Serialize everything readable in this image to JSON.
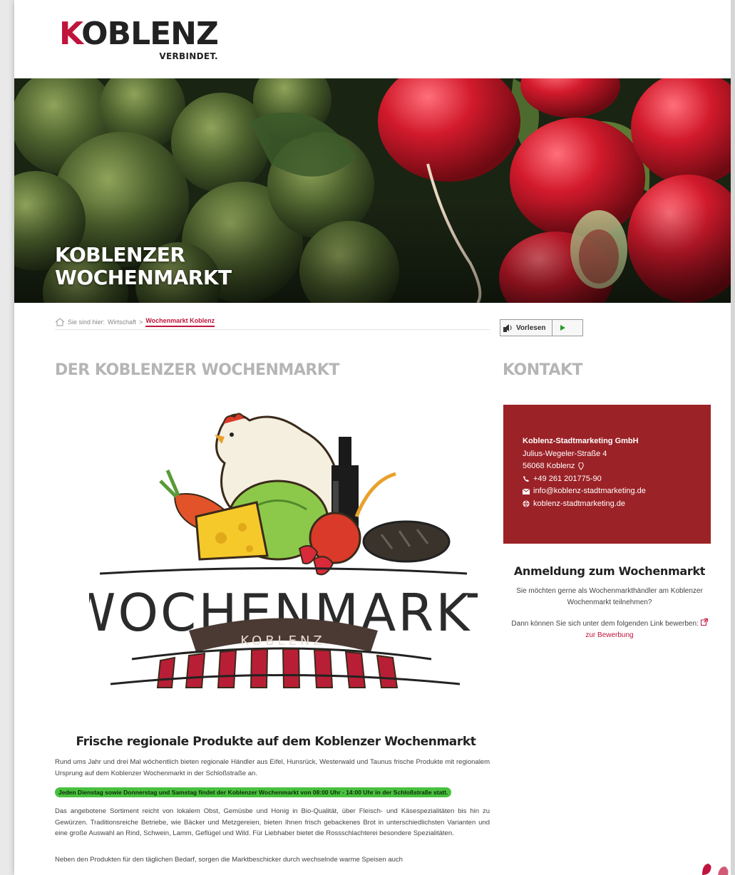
{
  "header": {
    "logo_word": "KOBLENZ",
    "logo_k": "K",
    "logo_rest": "OBLENZ",
    "logo_tagline": "VERBINDET."
  },
  "hero": {
    "title_line1": "KOBLENZER",
    "title_line2": "WOCHENMARKT"
  },
  "breadcrumb": {
    "prefix": "Sie sind hier:",
    "parent": "Wirtschaft",
    "separator": ">",
    "current": "Wochenmarkt Koblenz"
  },
  "reader": {
    "label": "Vorlesen"
  },
  "main": {
    "heading": "DER KOBLENZER WOCHENMARKT",
    "logo": {
      "word": "WOCHENMARKT",
      "sub": "KOBLENZ"
    },
    "subheading": "Frische regionale Produkte auf dem Koblenzer Wochenmarkt",
    "paragraph1": "Rund ums Jahr und drei Mal wöchentlich bieten regionale Händler aus Eifel, Hunsrück, Westerwald und Taunus frische Produkte mit regionalem Ursprung auf dem Koblenzer Wochenmarkt in der Schloßstraße an.",
    "highlight": "Jeden Dienstag sowie Donnerstag und Samstag findet der Koblenzer Wochenmarkt von 08:00 Uhr - 14:00 Uhr in der Schloßstraße statt.",
    "paragraph2": "Das angebotene Sortiment reicht von lokalem Obst, Gemüsbe und Honig in Bio-Qualität, über Fleisch- und Käsespezialitäten bis hin zu Gewürzen. Traditionsreiche Betriebe, wie Bäcker und Metzgereien, bieten Ihnen frisch gebackenes Brot in unterschiedlichsten Varianten und eine große Auswahl an Rind, Schwein, Lamm, Geflügel und Wild. Für Liebhaber bietet die Rossschlachterei besondere Spezialitäten.",
    "paragraph3": "Neben den Produkten für den täglichen Bedarf, sorgen die Marktbeschicker durch wechselnde warme Speisen auch"
  },
  "sidebar": {
    "heading": "KONTAKT",
    "contact": {
      "company": "Koblenz-Stadtmarketing GmbH",
      "street": "Julius-Wegeler-Straße 4",
      "city": "56068 Koblenz",
      "phone": "+49 261 201775-90",
      "email": "info@koblenz-stadtmarketing.de",
      "web": "koblenz-stadtmarketing.de"
    },
    "registration": {
      "title": "Anmeldung zum Wochenmarkt",
      "text1": "Sie möchten gerne als Wochenmarkthändler am Koblenzer Wochenmarkt teilnehmen?",
      "text2": "Dann können Sie sich unter dem folgenden Link bewerben:",
      "link_label": "zur Bewerbung"
    }
  },
  "colors": {
    "brand_red": "#c0143c",
    "contact_bg": "#9b2227",
    "highlight_green": "#49c13e",
    "heading_grey": "#b5b5b5"
  }
}
